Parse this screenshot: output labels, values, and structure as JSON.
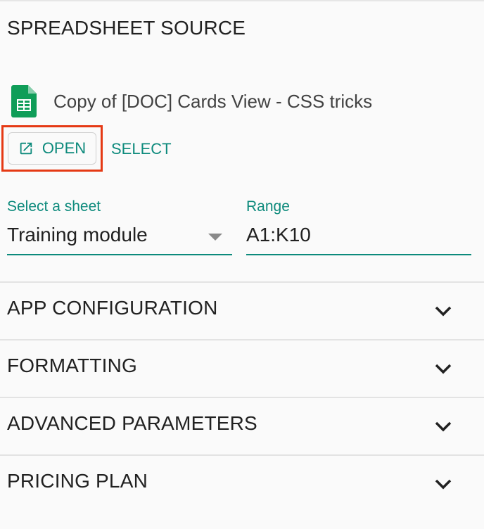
{
  "spreadsheet_source": {
    "title": "SPREADSHEET SOURCE",
    "file_name": "Copy of [DOC] Cards View - CSS tricks",
    "open_label": "OPEN",
    "select_label": "SELECT",
    "sheet_label": "Select a sheet",
    "sheet_value": "Training module",
    "range_label": "Range",
    "range_value": "A1:K10"
  },
  "sections": [
    {
      "label": "APP CONFIGURATION"
    },
    {
      "label": "FORMATTING"
    },
    {
      "label": "ADVANCED PARAMETERS"
    },
    {
      "label": "PRICING PLAN"
    }
  ],
  "colors": {
    "accent": "#0d8a7c",
    "highlight": "#e53914",
    "sheets_icon": "#0f9d58"
  },
  "icons": {
    "file": "google-sheets-icon",
    "open": "open-in-new-icon",
    "expand": "chevron-down-icon"
  }
}
